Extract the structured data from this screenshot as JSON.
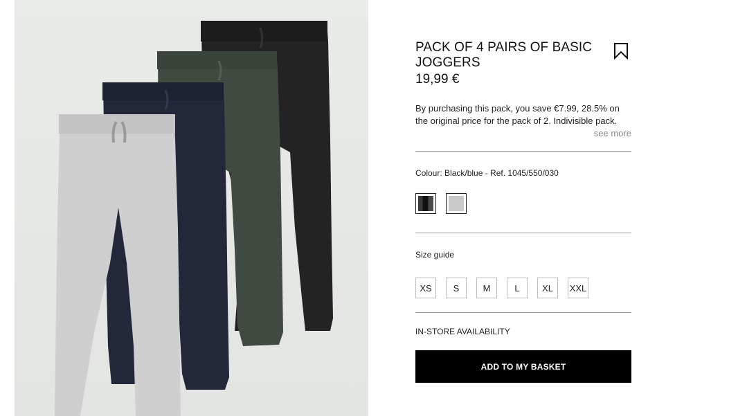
{
  "product": {
    "title": "PACK OF 4 PAIRS OF BASIC JOGGERS",
    "price": "19,99 €",
    "description": "By purchasing this pack, you save €7.99, 28.5% on the original price for the pack of 2. Indivisible pack.",
    "see_more": "see more",
    "image_icon": "joggers-product-photo"
  },
  "colour": {
    "label": "Colour: Black/blue - Ref. 1045/550/030",
    "swatches": [
      {
        "name": "black-blue",
        "color": "#1a1a1a"
      },
      {
        "name": "grey",
        "color": "#c9c9c9"
      }
    ]
  },
  "size_guide": "Size guide",
  "sizes": [
    "XS",
    "S",
    "M",
    "L",
    "XL",
    "XXL"
  ],
  "availability": "IN-STORE AVAILABILITY",
  "basket_button": "ADD TO MY BASKET",
  "icons": {
    "bookmark": "bookmark-icon"
  }
}
